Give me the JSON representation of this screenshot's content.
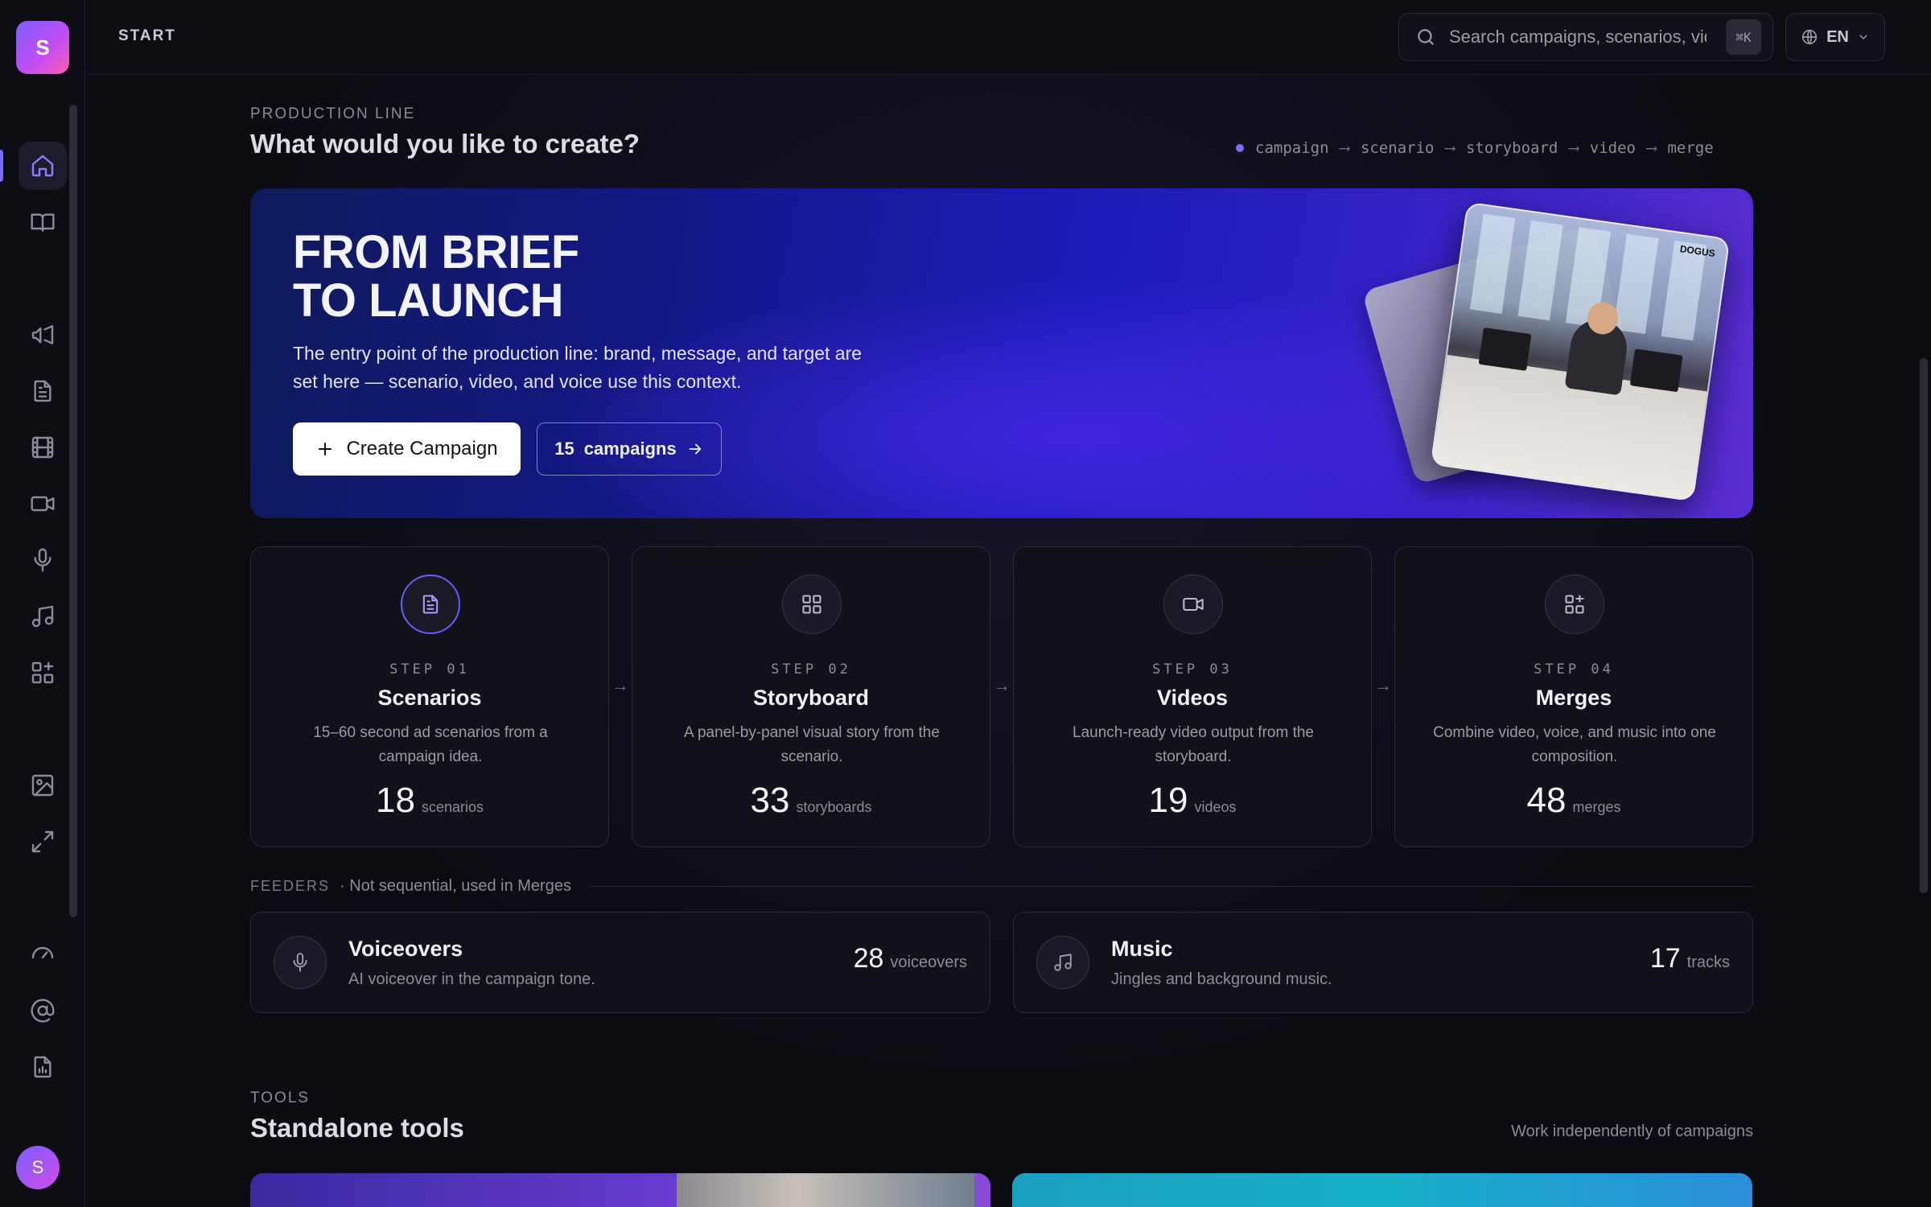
{
  "app": {
    "logo_letter": "S",
    "avatar_letter": "S"
  },
  "header": {
    "breadcrumb": "START",
    "search_placeholder": "Search campaigns, scenarios, videos...",
    "search_shortcut": "⌘K",
    "language": "EN"
  },
  "sidebar": {
    "items": [
      {
        "icon": "home-icon",
        "active": true
      },
      {
        "icon": "book-icon"
      },
      {
        "icon": "megaphone-icon"
      },
      {
        "icon": "document-icon"
      },
      {
        "icon": "film-icon"
      },
      {
        "icon": "video-icon"
      },
      {
        "icon": "microphone-icon"
      },
      {
        "icon": "music-icon"
      },
      {
        "icon": "merge-icon"
      },
      {
        "icon": "image-icon"
      },
      {
        "icon": "expand-icon"
      },
      {
        "icon": "gauge-icon"
      },
      {
        "icon": "at-icon"
      },
      {
        "icon": "report-icon"
      }
    ]
  },
  "production": {
    "label": "PRODUCTION LINE",
    "title": "What would you like to create?",
    "pipeline": [
      "campaign",
      "scenario",
      "storyboard",
      "video",
      "merge"
    ],
    "pipeline_arrow": "⟶"
  },
  "hero": {
    "title_line1": "FROM BRIEF",
    "title_line2": "TO LAUNCH",
    "description": "The entry point of the production line: brand, message, and target are set here — scenario, video, and voice use this context.",
    "primary_button": "Create Campaign",
    "secondary_count": "15",
    "secondary_label": "campaigns",
    "photo_brand": "DOGUS"
  },
  "steps": [
    {
      "step": "STEP 01",
      "name": "Scenarios",
      "description": "15–60 second ad scenarios from a campaign idea.",
      "count": "18",
      "unit": "scenarios",
      "icon": "document-icon"
    },
    {
      "step": "STEP 02",
      "name": "Storyboard",
      "description": "A panel-by-panel visual story from the scenario.",
      "count": "33",
      "unit": "storyboards",
      "icon": "grid-icon"
    },
    {
      "step": "STEP 03",
      "name": "Videos",
      "description": "Launch-ready video output from the storyboard.",
      "count": "19",
      "unit": "videos",
      "icon": "video-icon"
    },
    {
      "step": "STEP 04",
      "name": "Merges",
      "description": "Combine video, voice, and music into one composition.",
      "count": "48",
      "unit": "merges",
      "icon": "merge-icon"
    }
  ],
  "feeders": {
    "label": "FEEDERS",
    "subtitle": "· Not sequential, used in Merges",
    "items": [
      {
        "title": "Voiceovers",
        "description": "AI voiceover in the campaign tone.",
        "count": "28",
        "unit": "voiceovers",
        "icon": "microphone-icon"
      },
      {
        "title": "Music",
        "description": "Jingles and background music.",
        "count": "17",
        "unit": "tracks",
        "icon": "music-icon"
      }
    ]
  },
  "tools": {
    "label": "TOOLS",
    "title": "Standalone tools",
    "note": "Work independently of campaigns"
  },
  "colors": {
    "accent": "#7c6cff",
    "background": "#0b0b12",
    "card": "#111119"
  }
}
